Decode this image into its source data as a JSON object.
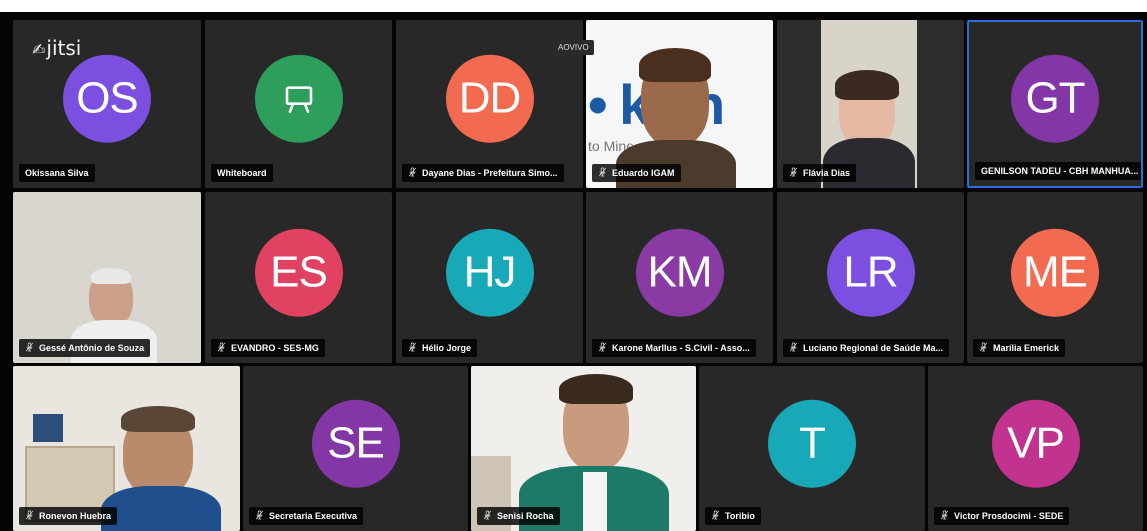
{
  "app": {
    "logo_text": "jitsi",
    "live_badge": "AOVIVO"
  },
  "colors": {
    "stage_bg": "#040404",
    "tile_bg": "#282828",
    "active_border": "#2b6fd6",
    "label_bg": "#000000",
    "label_text": "#ffffff"
  },
  "participants": [
    {
      "name": "Okissana Silva",
      "initials": "OS",
      "avatar_color": "#7b4fe0",
      "muted": false,
      "type": "avatar"
    },
    {
      "name": "Whiteboard",
      "initials": "",
      "avatar_color": "#2e9e5c",
      "muted": false,
      "type": "whiteboard",
      "icon": "whiteboard-icon"
    },
    {
      "name": "Dayane Dias - Prefeitura Simo...",
      "initials": "DD",
      "avatar_color": "#f26a4f",
      "muted": true,
      "type": "avatar"
    },
    {
      "name": "Eduardo IGAM",
      "initials": "",
      "muted": true,
      "type": "video",
      "background_text": "to Mine   estão das"
    },
    {
      "name": "Flávia Dias",
      "initials": "",
      "muted": true,
      "type": "video"
    },
    {
      "name": "GENILSON TADEU - CBH MANHUA...",
      "initials": "GT",
      "avatar_color": "#8336a6",
      "muted": false,
      "type": "avatar",
      "active_speaker": true
    },
    {
      "name": "Gessé Antônio de Souza",
      "initials": "",
      "muted": true,
      "type": "video"
    },
    {
      "name": "EVANDRO - SES-MG",
      "initials": "ES",
      "avatar_color": "#e24262",
      "muted": true,
      "type": "avatar"
    },
    {
      "name": "Hélio Jorge",
      "initials": "HJ",
      "avatar_color": "#17a9b8",
      "muted": true,
      "type": "avatar"
    },
    {
      "name": "Karone Marllus - S.Civil - Asso...",
      "initials": "KM",
      "avatar_color": "#8a3ba3",
      "muted": true,
      "type": "avatar"
    },
    {
      "name": "Luciano Regional de Saúde Ma...",
      "initials": "LR",
      "avatar_color": "#7b4fe0",
      "muted": true,
      "type": "avatar"
    },
    {
      "name": "Marília Emerick",
      "initials": "ME",
      "avatar_color": "#f26a4f",
      "muted": true,
      "type": "avatar"
    },
    {
      "name": "Ronevon Huebra",
      "initials": "",
      "muted": true,
      "type": "video"
    },
    {
      "name": "Secretaria Executiva",
      "initials": "SE",
      "avatar_color": "#8336a6",
      "muted": true,
      "type": "avatar"
    },
    {
      "name": "Senisi Rocha",
      "initials": "",
      "muted": true,
      "type": "video"
    },
    {
      "name": "Toribio",
      "initials": "T",
      "avatar_color": "#17a9b8",
      "muted": true,
      "type": "avatar"
    },
    {
      "name": "Victor Prosdocimi - SEDE",
      "initials": "VP",
      "avatar_color": "#c2338f",
      "muted": true,
      "type": "avatar"
    }
  ]
}
